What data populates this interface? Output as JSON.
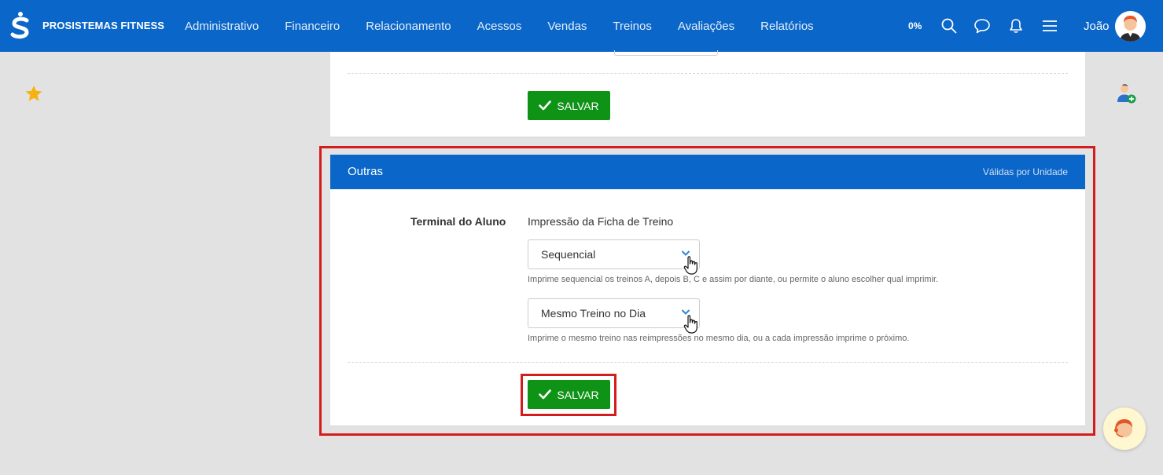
{
  "header": {
    "brand": "PROSISTEMAS FITNESS",
    "nav": [
      "Administrativo",
      "Financeiro",
      "Relacionamento",
      "Acessos",
      "Vendas",
      "Treinos",
      "Avaliações",
      "Relatórios"
    ],
    "progress": "0%",
    "user_name": "João",
    "icons": [
      "search-icon",
      "chat-icon",
      "bell-icon",
      "menu-icon"
    ]
  },
  "top_card": {
    "save_label": "SALVAR"
  },
  "outras": {
    "title": "Outras",
    "note": "Válidas por Unidade",
    "field_label": "Terminal do Aluno",
    "field_title": "Impressão da Ficha de Treino",
    "select1": {
      "value": "Sequencial",
      "help": "Imprime sequencial os treinos A, depois B, C e assim por diante, ou permite o aluno escolher qual imprimir."
    },
    "select2": {
      "value": "Mesmo Treino no Dia",
      "help": "Imprime o mesmo treino nas reimpressões no mesmo dia, ou a cada impressão imprime o próximo."
    },
    "save_label": "SALVAR"
  },
  "colors": {
    "primary": "#0a66c8",
    "save": "#0f9317",
    "highlight": "#d41c1c",
    "background": "#e2e2e2"
  }
}
